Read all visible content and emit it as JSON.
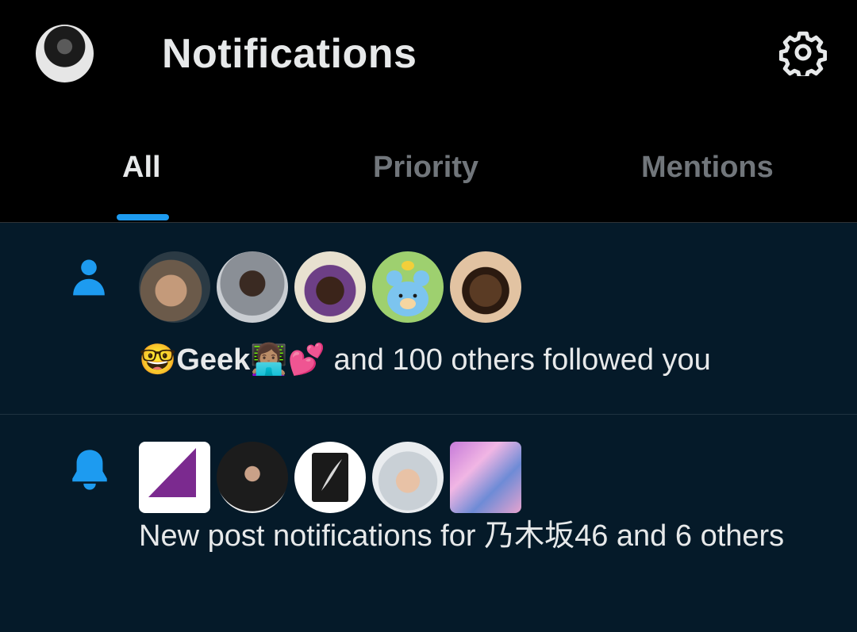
{
  "header": {
    "title": "Notifications",
    "profile_icon": "profile-avatar",
    "settings_icon": "gear-icon"
  },
  "tabs": [
    {
      "label": "All",
      "active": true
    },
    {
      "label": "Priority",
      "active": false
    },
    {
      "label": "Mentions",
      "active": false
    }
  ],
  "colors": {
    "accent": "#1d9bf0",
    "background": "#000000",
    "feed_background": "#051a29",
    "text_primary": "#e7e9ea",
    "text_secondary": "#71767b"
  },
  "notifications": [
    {
      "type_icon": "person-icon",
      "avatars": [
        "dog-avatar",
        "man-avatar",
        "woman-avatar",
        "bear-avatar",
        "man-avatar"
      ],
      "name": "🤓Geek👩🏽‍💻💕",
      "text": " and 100 others followed you"
    },
    {
      "type_icon": "bell-icon",
      "avatars": [
        "nogizaka46-logo",
        "man-avatar",
        "book-avatar",
        "person-avatar",
        "collage-avatar"
      ],
      "text": "New post notifications for 乃木坂46 and 6 others"
    }
  ]
}
